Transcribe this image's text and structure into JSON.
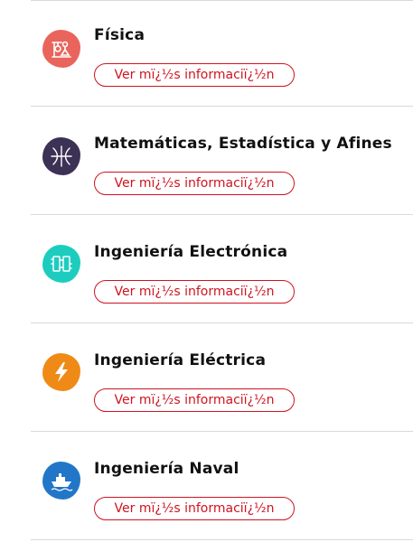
{
  "careers": [
    {
      "title": "Física",
      "button_label": "Ver mï¿½s informaciï¿½n",
      "icon": "physics-icon",
      "icon_color": "#e9645c"
    },
    {
      "title": "Matemáticas, Estadística y Afines",
      "button_label": "Ver mï¿½s informaciï¿½n",
      "icon": "intersection-icon",
      "icon_color": "#3b3256"
    },
    {
      "title": "Ingeniería Electrónica",
      "button_label": "Ver mï¿½s informaciï¿½n",
      "icon": "circuit-icon",
      "icon_color": "#1ccdbf"
    },
    {
      "title": "Ingeniería Eléctrica",
      "button_label": "Ver mï¿½s informaciï¿½n",
      "icon": "lightning-icon",
      "icon_color": "#ef8a17"
    },
    {
      "title": "Ingeniería Naval",
      "button_label": "Ver mï¿½s informaciï¿½n",
      "icon": "ship-icon",
      "icon_color": "#2176c8"
    }
  ],
  "colors": {
    "button_accent": "#d0131f",
    "title_text": "#111111",
    "divider": "#d9d9d9"
  }
}
